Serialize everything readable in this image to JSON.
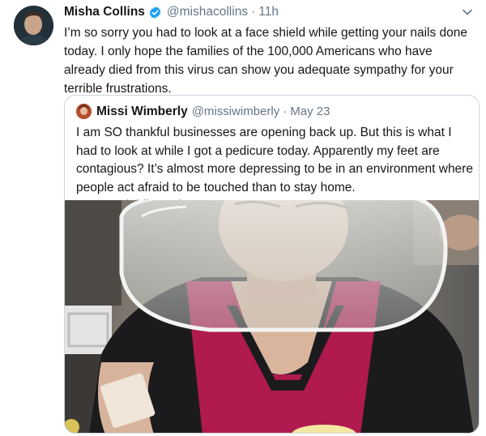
{
  "tweet": {
    "author_name": "Misha Collins",
    "author_handle": "@mishacollins",
    "separator": "·",
    "time": "11h",
    "verified_icon": "verified-badge-icon",
    "menu_icon": "chevron-down-icon",
    "text": "I’m so sorry you had to look at a face shield while getting your nails done today. I only hope the families of the 100,000 Americans who have already died from this virus can show you adequate sympathy for your terrible frustrations."
  },
  "quoted_tweet": {
    "author_name": "Missi Wimberly",
    "author_handle": "@missiwimberly",
    "separator": "·",
    "time": "May 23",
    "text": "I am SO thankful businesses are opening back up. But this is what I had to look at while I got a pedicure today. Apparently my feet are contagious? It’s almost more depressing to be in an environment where people act afraid to be touched than to stay home. #stopsocialdistancing"
  },
  "colors": {
    "primary_text": "#14171a",
    "secondary_text": "#657786",
    "verified_blue": "#1da1f2",
    "border": "#ccd6dd",
    "apron_pink": "#b01a4e"
  }
}
